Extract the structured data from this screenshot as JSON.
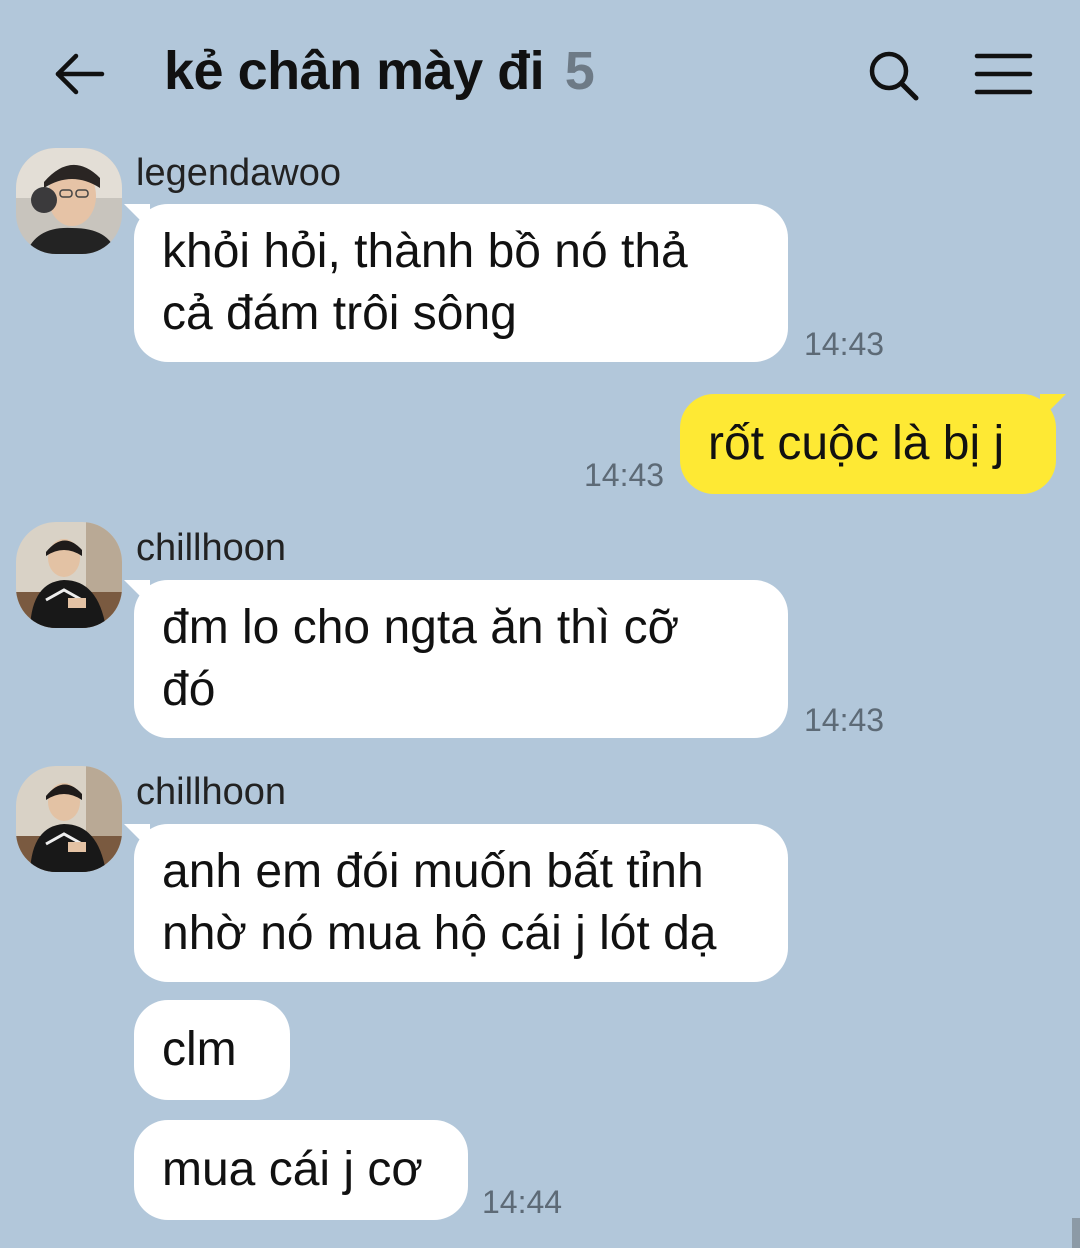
{
  "header": {
    "title": "kẻ chân mày đi",
    "member_count": "5"
  },
  "messages": [
    {
      "sender": "legendawoo",
      "lines": [
        "khỏi hỏi, thành bồ nó thả",
        "cả đám trôi sông"
      ],
      "time": "14:43"
    },
    {
      "mine": true,
      "lines": [
        "rốt cuộc là bị j"
      ],
      "time": "14:43"
    },
    {
      "sender": "chillhoon",
      "lines": [
        "đm lo cho ngta ăn thì cỡ",
        "đó"
      ],
      "time": "14:43"
    },
    {
      "sender": "chillhoon",
      "lines": [
        "anh em đói muốn bất tỉnh",
        "nhờ nó mua hộ cái j lót dạ"
      ]
    },
    {
      "lines": [
        "clm"
      ]
    },
    {
      "lines": [
        "mua cái j cơ"
      ],
      "time": "14:44"
    }
  ],
  "icons": {
    "back": "arrow-left-icon",
    "search": "search-icon",
    "menu": "hamburger-menu-icon"
  },
  "colors": {
    "background": "#b2c7da",
    "my_bubble": "#fee934",
    "their_bubble": "#ffffff"
  }
}
